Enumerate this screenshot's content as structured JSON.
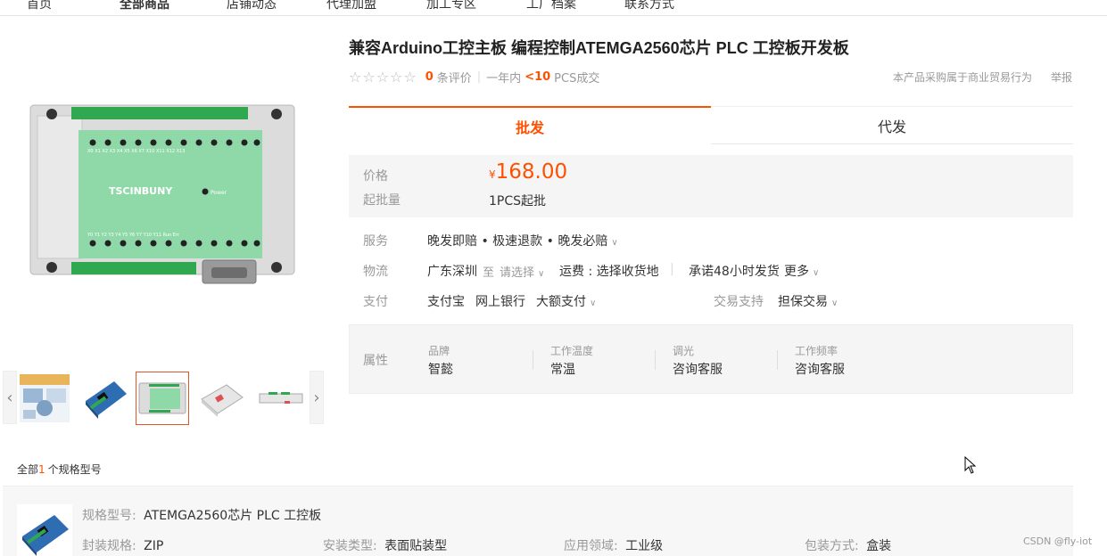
{
  "nav": {
    "items": [
      "首页",
      "全部商品",
      "店铺动态",
      "代理加盟",
      "加工专区",
      "工厂档案",
      "联系方式"
    ]
  },
  "product": {
    "title": "兼容Arduino工控主板 编程控制ATEMGA2560芯片 PLC 工控板开发板",
    "review_count": "0",
    "review_label": "条评价",
    "sales_prefix": "一年内",
    "sales_value": "<10",
    "sales_suffix": "PCS成交",
    "trade_note": "本产品采购属于商业贸易行为",
    "report": "举报"
  },
  "board": {
    "brand_text": "TSCINBUNY",
    "power_text": "Power",
    "top_labels": [
      "X0",
      "X1",
      "X2",
      "X3",
      "X4",
      "X5",
      "X6",
      "X7",
      "X10",
      "X11",
      "X12",
      "X13"
    ],
    "bottom_labels": [
      "Y0",
      "Y1",
      "Y2",
      "Y3",
      "Y4",
      "Y5",
      "Y6",
      "Y7",
      "Y10",
      "Y11",
      "Run",
      "Err"
    ]
  },
  "tabs": {
    "wholesale": "批发",
    "dropship": "代发"
  },
  "price": {
    "price_label": "价格",
    "currency": "¥",
    "amount": "168.00",
    "moq_label": "起批量",
    "moq_value": "1PCS起批"
  },
  "service": {
    "label": "服务",
    "value": "晚发即赔 • 极速退款 • 晚发必赔"
  },
  "logistics": {
    "label": "物流",
    "origin": "广东深圳",
    "to": "至",
    "select": "请选择",
    "freight": "运费 : 选择收货地",
    "promise": "承诺48小时发货",
    "more": "更多"
  },
  "payment": {
    "label": "支付",
    "methods": [
      "支付宝",
      "网上银行",
      "大额支付"
    ],
    "support_label": "交易支持",
    "support_value": "担保交易"
  },
  "attributes": {
    "label": "属性",
    "items": [
      {
        "key": "品牌",
        "value": "智懿"
      },
      {
        "key": "工作温度",
        "value": "常温"
      },
      {
        "key": "调光",
        "value": "咨询客服"
      },
      {
        "key": "工作频率",
        "value": "咨询客服"
      }
    ]
  },
  "specs": {
    "count_prefix": "全部",
    "count": "1",
    "count_suffix": "个规格型号",
    "model_key": "规格型号:",
    "model_value": "ATEMGA2560芯片 PLC 工控板",
    "package_key": "封装规格:",
    "package_value": "ZIP",
    "mount_key": "安装类型:",
    "mount_value": "表面贴装型",
    "field_key": "应用领域:",
    "field_value": "工业级",
    "packing_key": "包装方式:",
    "packing_value": "盒装"
  },
  "watermark": "CSDN @fly-iot",
  "colors": {
    "accent": "#ff5000",
    "board_green": "#8fd9a8",
    "terminal_green": "#2fa84f"
  }
}
